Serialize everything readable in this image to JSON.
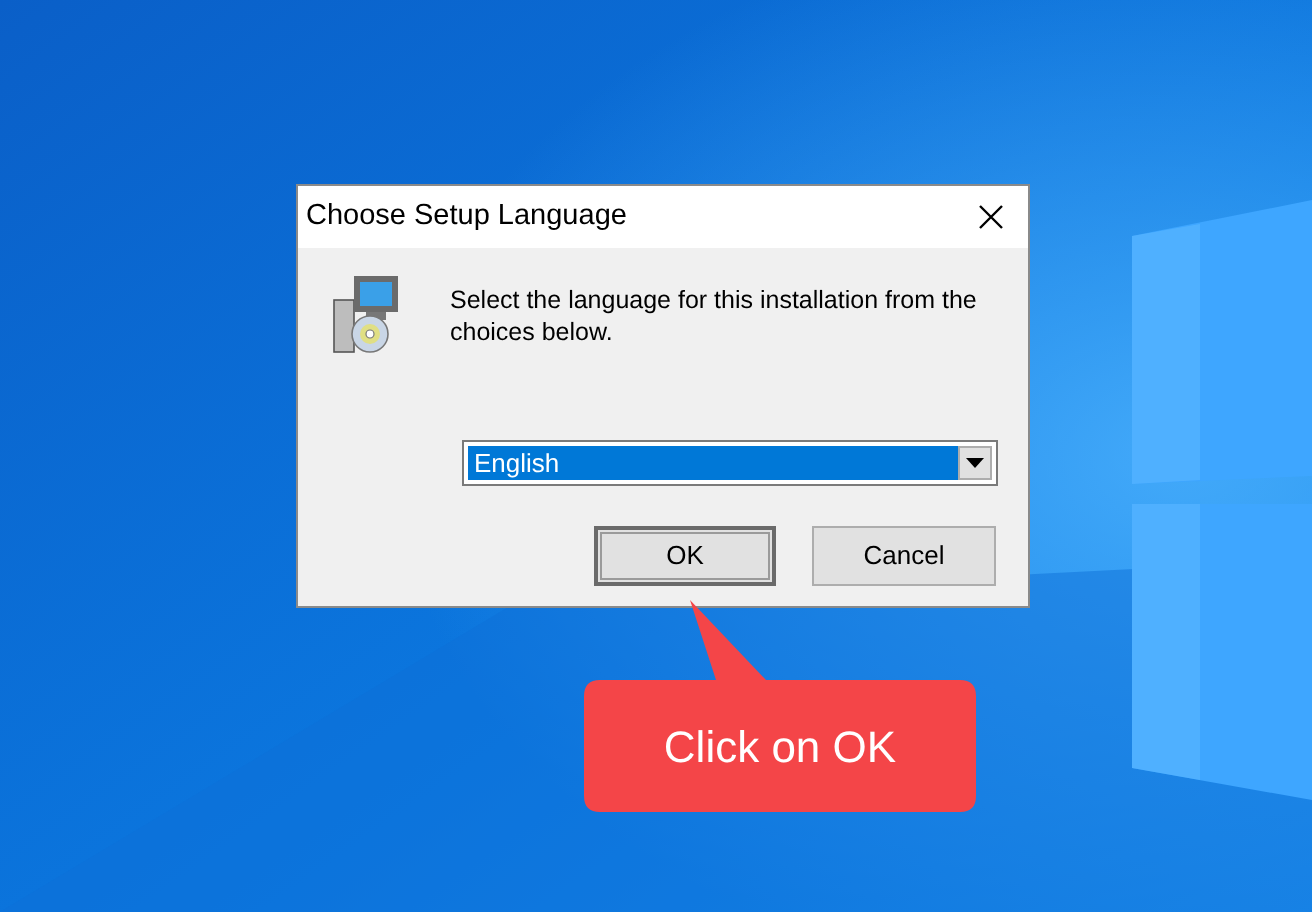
{
  "dialog": {
    "title": "Choose Setup Language",
    "message": "Select the language for this installation from the choices below.",
    "language_select": {
      "value": "English",
      "highlighted": true
    },
    "buttons": [
      {
        "label": "OK",
        "default": true
      },
      {
        "label": "Cancel",
        "default": false
      }
    ]
  },
  "callout": {
    "text": "Click on OK"
  }
}
